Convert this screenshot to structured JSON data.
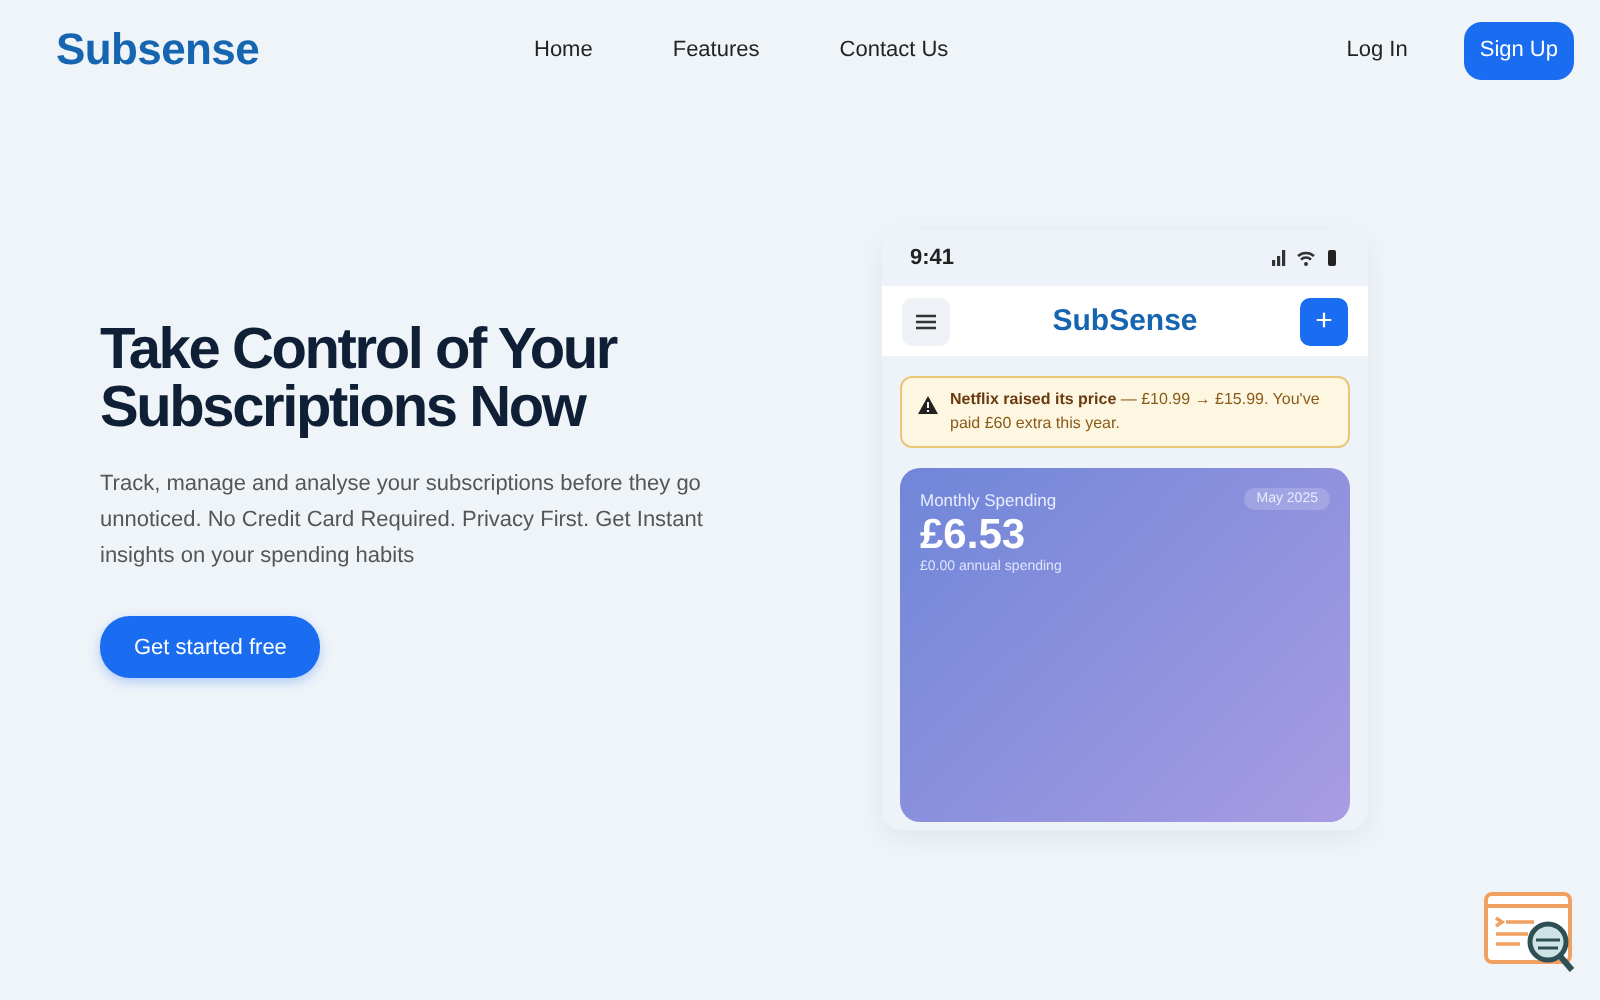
{
  "header": {
    "logo": "Subsense",
    "nav": [
      "Home",
      "Features",
      "Contact Us"
    ],
    "login": "Log In",
    "signup": "Sign Up"
  },
  "hero": {
    "title": "Take Control of Your Subscriptions Now",
    "text": "Track, manage and analyse your subscriptions before they go unnoticed. No Credit Card Required. Privacy First. Get Instant insights on your spending habits",
    "cta": "Get started free"
  },
  "phone": {
    "time": "9:41",
    "app_title": "SubSense",
    "add": "+",
    "alert": "**Netflix raised its price** — £10.99 → £15.99. You've paid £60 extra this year.",
    "card": {
      "label": "Monthly Spending",
      "period": "May 2025",
      "amount": "£6.53",
      "annual": "£0.00 annual spending"
    }
  }
}
